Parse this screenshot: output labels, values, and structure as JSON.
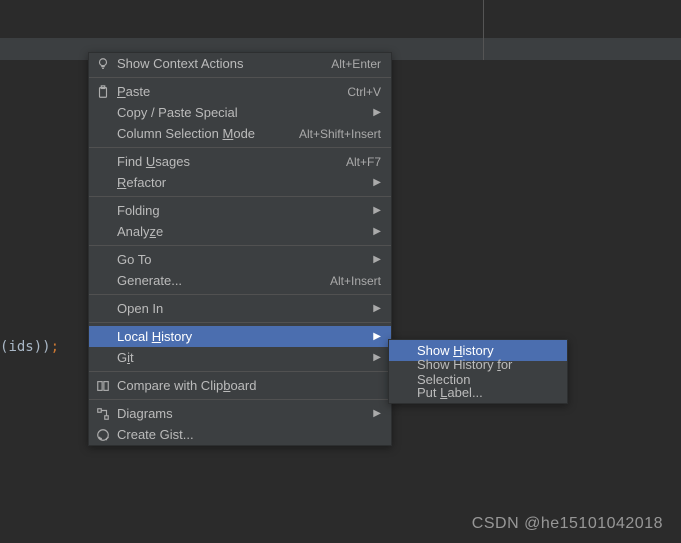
{
  "code_fragment": {
    "text": "(ids));",
    "paren": "(",
    "ident": "ids",
    "close": "))",
    "semi": ";"
  },
  "main_menu": {
    "groups": [
      [
        {
          "key": "show-context-actions",
          "label": "Show Context Actions",
          "shortcut": "Alt+Enter",
          "icon": "bulb"
        }
      ],
      [
        {
          "key": "paste",
          "label_pre": "",
          "u": "P",
          "label_post": "aste",
          "shortcut": "Ctrl+V",
          "icon": "clipboard"
        },
        {
          "key": "copy-paste-special",
          "label": "Copy / Paste Special",
          "submenu": true
        },
        {
          "key": "column-selection-mode",
          "label_pre": "Column Selection ",
          "u": "M",
          "label_post": "ode",
          "shortcut": "Alt+Shift+Insert"
        }
      ],
      [
        {
          "key": "find-usages",
          "label_pre": "Find ",
          "u": "U",
          "label_post": "sages",
          "shortcut": "Alt+F7"
        },
        {
          "key": "refactor",
          "label_pre": "",
          "u": "R",
          "label_post": "efactor",
          "submenu": true
        }
      ],
      [
        {
          "key": "folding",
          "label": "Folding",
          "submenu": true
        },
        {
          "key": "analyze",
          "label_pre": "Analy",
          "u": "z",
          "label_post": "e",
          "submenu": true
        }
      ],
      [
        {
          "key": "go-to",
          "label": "Go To",
          "submenu": true
        },
        {
          "key": "generate",
          "label": "Generate...",
          "shortcut": "Alt+Insert"
        }
      ],
      [
        {
          "key": "open-in",
          "label": "Open In",
          "submenu": true
        }
      ],
      [
        {
          "key": "local-history",
          "label_pre": "Local ",
          "u": "H",
          "label_post": "istory",
          "submenu": true,
          "hover": true
        },
        {
          "key": "git",
          "label_pre": "G",
          "u": "i",
          "label_post": "t",
          "submenu": true
        }
      ],
      [
        {
          "key": "compare-clipboard",
          "label_pre": "Compare with Clip",
          "u": "b",
          "label_post": "oard",
          "icon": "compare"
        }
      ],
      [
        {
          "key": "diagrams",
          "label": "Diagrams",
          "submenu": true,
          "icon": "diagram"
        },
        {
          "key": "create-gist",
          "label": "Create Gist...",
          "icon": "github"
        }
      ]
    ]
  },
  "sub_menu": {
    "items": [
      {
        "key": "show-history",
        "label_pre": "Show ",
        "u": "H",
        "label_post": "istory",
        "hover": true
      },
      {
        "key": "show-history-selection",
        "label_pre": "Show History ",
        "u": "f",
        "label_post": "or Selection"
      },
      {
        "key": "put-label",
        "label_pre": "Put ",
        "u": "L",
        "label_post": "abel..."
      }
    ]
  },
  "watermark": "CSDN @he15101042018"
}
